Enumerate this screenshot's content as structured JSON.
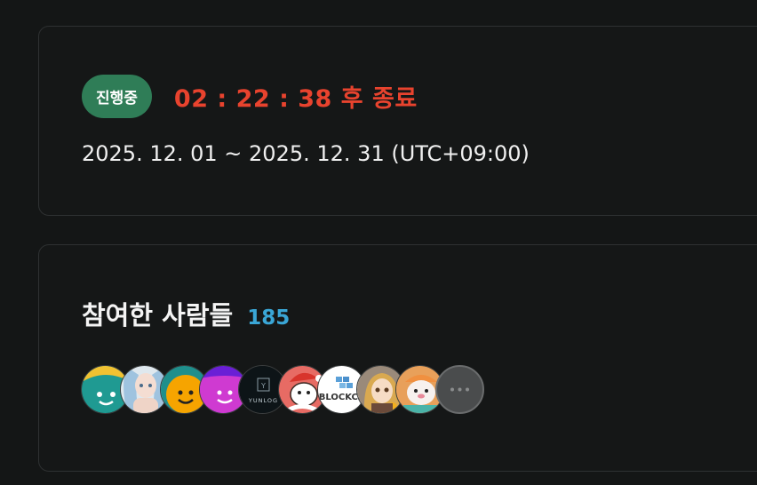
{
  "status": {
    "badge_label": "진행중",
    "countdown": "02 : 22 : 38 후 종료",
    "period": "2025. 12. 01 ~ 2025. 12. 31 (UTC+09:00)"
  },
  "participants": {
    "title": "참여한 사람들",
    "count": "185",
    "avatars": [
      {
        "name": "teal-smiley-avatar"
      },
      {
        "name": "anime-girl-avatar"
      },
      {
        "name": "orange-smiley-avatar"
      },
      {
        "name": "purple-smiley-avatar"
      },
      {
        "name": "yunlog-avatar",
        "text": "YUNLOG"
      },
      {
        "name": "santa-dog-avatar"
      },
      {
        "name": "blockchain-avatar",
        "text": "BLOCKCH"
      },
      {
        "name": "blonde-character-avatar"
      },
      {
        "name": "seal-character-avatar"
      }
    ],
    "more_label": "more-participants"
  },
  "colors": {
    "badge_bg": "#2f7d57",
    "countdown": "#e8432e",
    "count": "#3aa6d6",
    "background": "#141616"
  }
}
